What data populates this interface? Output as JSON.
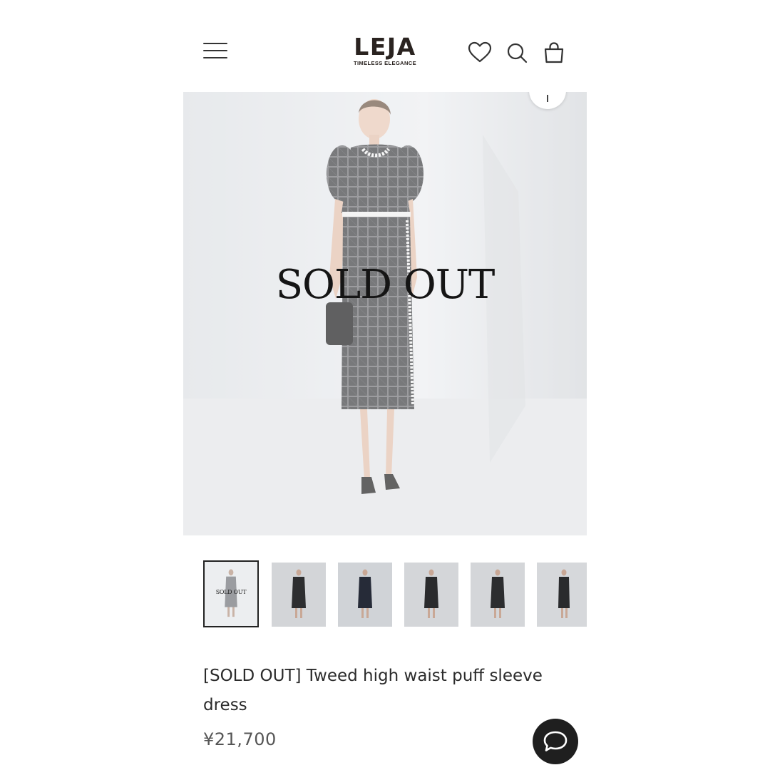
{
  "header": {
    "menu_icon": "hamburger-menu-icon",
    "logo_main": "LEJA",
    "logo_sub": "TIMELESS ELEGANCE",
    "icons": [
      "heart-icon",
      "search-icon",
      "shopping-bag-icon"
    ]
  },
  "hero": {
    "overlay_text": "SOLD OUT",
    "zoom_icon": "zoom-icon"
  },
  "thumbnails": {
    "count_visible": 6,
    "active_index": 0,
    "active_overlay_text": "SOLD OUT"
  },
  "product": {
    "title": "[SOLD OUT] Tweed high waist puff sleeve dress",
    "price": "¥21,700"
  },
  "chat": {
    "icon": "chat-bubble-icon"
  },
  "colors": {
    "text": "#2b2b2b",
    "chat_bg": "#1f1f1f",
    "hero_bg": "#e9ebee"
  }
}
